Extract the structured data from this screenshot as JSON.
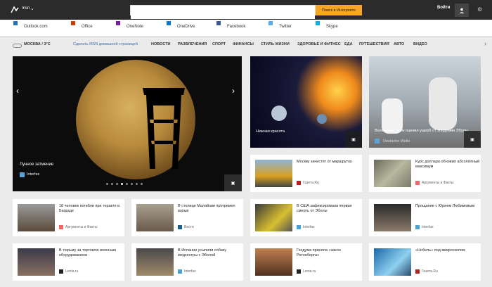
{
  "header": {
    "logo_text": "msn",
    "search_placeholder": "",
    "search_button": "Поиск в Интернете",
    "signin": "Войти"
  },
  "quicklinks": [
    {
      "label": "Outlook.com",
      "icon": "outlook-icon",
      "color": "#2372ba"
    },
    {
      "label": "Office",
      "icon": "office-icon",
      "color": "#d83b01"
    },
    {
      "label": "OneNote",
      "icon": "onenote-icon",
      "color": "#7719aa"
    },
    {
      "label": "OneDrive",
      "icon": "onedrive-icon",
      "color": "#0078d7"
    },
    {
      "label": "Facebook",
      "icon": "facebook-icon",
      "color": "#3b5998"
    },
    {
      "label": "Twitter",
      "icon": "twitter-icon",
      "color": "#55acee"
    },
    {
      "label": "Skype",
      "icon": "skype-icon",
      "color": "#00aff0"
    }
  ],
  "nav": {
    "weather": "МОСКВА / 3°C",
    "make_home": "Сделать MSN домашней страницей",
    "items": [
      "НОВОСТИ",
      "РАЗВЛЕЧЕНИЯ",
      "СПОРТ",
      "ФИНАНСЫ",
      "СТИЛЬ ЖИЗНИ",
      "ЗДОРОВЬЕ И ФИТНЕС",
      "ЕДА",
      "ПУТЕШЕСТВИЯ",
      "АВТО",
      "ВИДЕО"
    ]
  },
  "hero": {
    "title": "Лунное затмение",
    "source": "Interfax"
  },
  "big_tiles": [
    {
      "caption": "Нежная красота",
      "source": ""
    },
    {
      "caption": "Всемирный банк оценил ущерб от эпидемии Эболы",
      "source": "Deutsche Welle"
    }
  ],
  "cards_row1": [
    {
      "text": "Москву зачистят от маршруток",
      "source": "Газета.Ru"
    },
    {
      "text": "Курс доллара обновил абсолютный максимум",
      "source": "Аргументы и Факты"
    }
  ],
  "cards_row2": [
    {
      "text": "18 человек погибли при теракте в Багдаде",
      "source": "Аргументы и Факты"
    },
    {
      "text": "В столице Малайзии прогремел взрыв",
      "source": "Вести"
    },
    {
      "text": "В США зафиксирована первая смерть от Эболы",
      "source": "Interfax"
    },
    {
      "text": "Прощание с Юрием Любимовым",
      "source": "Interfax"
    }
  ],
  "cards_row3": [
    {
      "text": "В тюрьму за торговлю военным оборудованием",
      "source": "Lenta.ru"
    },
    {
      "text": "В Испании усыпили собаку медсестры с Эболой",
      "source": "Interfax"
    },
    {
      "text": "Госдума приняла «закон Ротенберга»",
      "source": "Lenta.ru"
    },
    {
      "text": "«Нобель» под микроскопом",
      "source": "Газета.Ru"
    }
  ]
}
